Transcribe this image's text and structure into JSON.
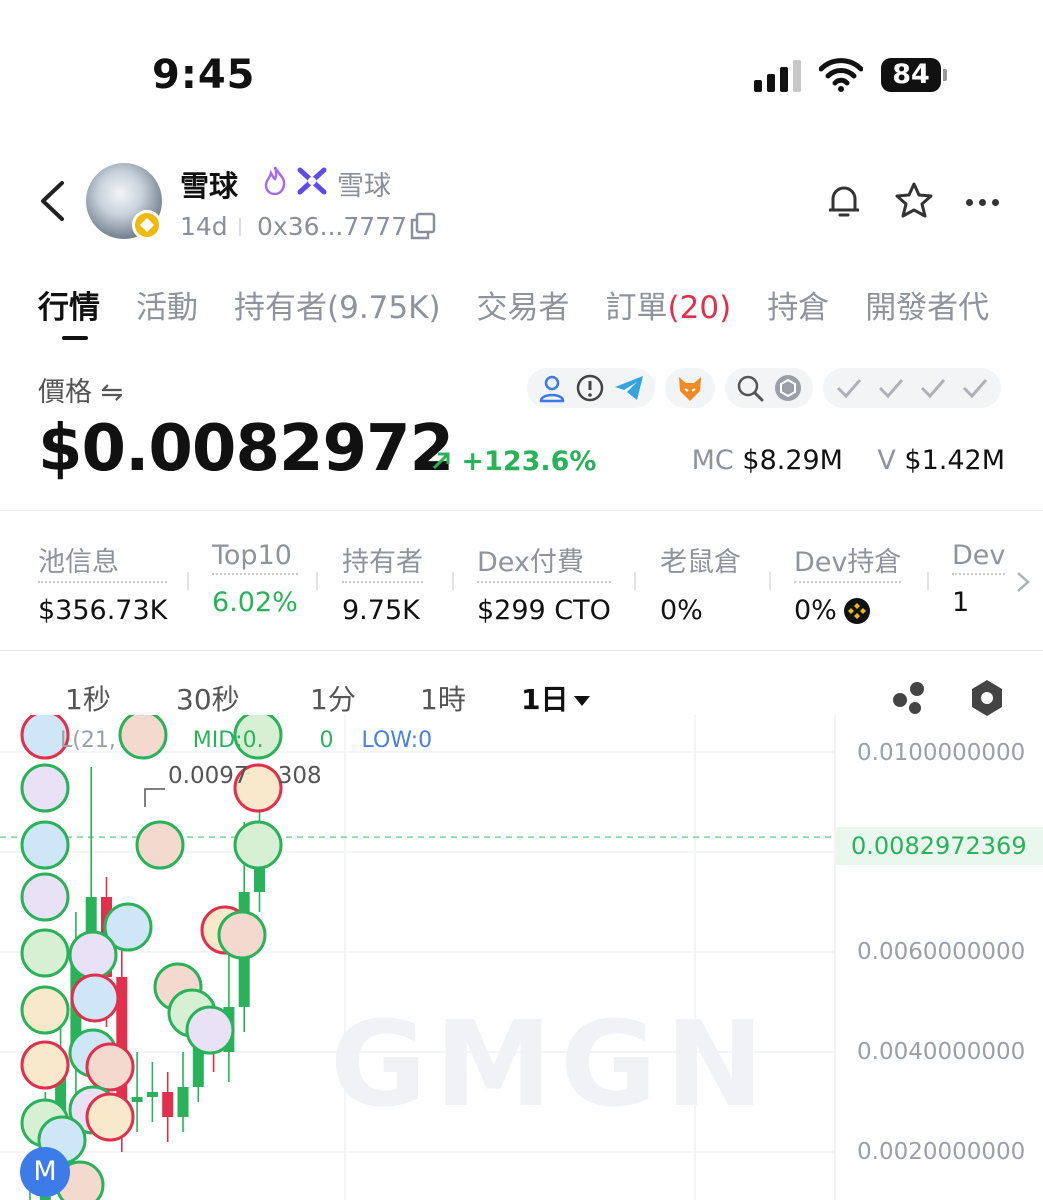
{
  "status_bar": {
    "time": "9:45",
    "battery": "84"
  },
  "header": {
    "token_name": "雪球",
    "alias": "雪球",
    "age": "14d",
    "address": "0x36...7777",
    "icons": [
      "back-arrow-icon",
      "bnb-chain-badge-icon",
      "flame-icon",
      "x-logo-icon",
      "copy-icon",
      "bell-icon",
      "star-icon",
      "more-icon"
    ]
  },
  "tabs": [
    {
      "label": "行情",
      "active": true
    },
    {
      "label": "活動"
    },
    {
      "label": "持有者(9.75K)"
    },
    {
      "label": "交易者"
    },
    {
      "label": "訂單",
      "count": "(20)"
    },
    {
      "label": "持倉"
    },
    {
      "label": "開發者代"
    }
  ],
  "price": {
    "label": "價格 ⇋",
    "value": "$0.0082972",
    "change": "+123.6%",
    "mc_label": "MC",
    "mc_value": "$8.29M",
    "v_label": "V",
    "v_value": "$1.42M"
  },
  "stats": [
    {
      "label": "池信息",
      "value": "$356.73K"
    },
    {
      "label": "Top10",
      "value": "6.02%",
      "green": true
    },
    {
      "label": "持有者",
      "value": "9.75K"
    },
    {
      "label": "Dex付費",
      "value": "$299 CTO"
    },
    {
      "label": "老鼠倉",
      "value": "0%"
    },
    {
      "label": "Dev持倉",
      "value": "0%"
    },
    {
      "label": "Dev",
      "value": "1"
    }
  ],
  "timeframes": [
    {
      "label": "1秒"
    },
    {
      "label": "30秒"
    },
    {
      "label": "1分"
    },
    {
      "label": "1時"
    },
    {
      "label": "1日",
      "active": true
    }
  ],
  "chart": {
    "ohlc_prefix": "L(21,",
    "mid": "MID:0.",
    "mid_tail": "0",
    "low": "LOW:0",
    "high_marker": "0.0097",
    "high_marker_tail": "308",
    "current_price": "0.0082972369",
    "watermark": "GMGN",
    "user_badge": "M",
    "up_color": "#2ab25b",
    "down_color": "#e0304d"
  },
  "chart_data": {
    "type": "candlestick",
    "y_axis_labels": [
      "0.0100000000",
      "0.0060000000",
      "0.0040000000",
      "0.0020000000"
    ],
    "ylim": [
      0.0004,
      0.0105
    ],
    "current_price": 0.0082972369,
    "candles_approx": [
      {
        "open": 0.0004,
        "close": 0.001,
        "high": 0.0014,
        "low": 0.0004
      },
      {
        "open": 0.001,
        "close": 0.002,
        "high": 0.0032,
        "low": 0.0004
      },
      {
        "open": 0.002,
        "close": 0.0038,
        "high": 0.0052,
        "low": 0.0015
      },
      {
        "open": 0.0038,
        "close": 0.0058,
        "high": 0.0068,
        "low": 0.003
      },
      {
        "open": 0.0058,
        "close": 0.0071,
        "high": 0.0097,
        "low": 0.005
      },
      {
        "open": 0.0071,
        "close": 0.0055,
        "high": 0.0075,
        "low": 0.0045
      },
      {
        "open": 0.0055,
        "close": 0.003,
        "high": 0.0062,
        "low": 0.002
      },
      {
        "open": 0.003,
        "close": 0.0031,
        "high": 0.004,
        "low": 0.0024
      },
      {
        "open": 0.0031,
        "close": 0.0032,
        "high": 0.0038,
        "low": 0.0026
      },
      {
        "open": 0.0032,
        "close": 0.0027,
        "high": 0.0036,
        "low": 0.0022
      },
      {
        "open": 0.0027,
        "close": 0.0033,
        "high": 0.004,
        "low": 0.0024
      },
      {
        "open": 0.0033,
        "close": 0.0044,
        "high": 0.0052,
        "low": 0.003
      },
      {
        "open": 0.0044,
        "close": 0.004,
        "high": 0.005,
        "low": 0.0036
      },
      {
        "open": 0.004,
        "close": 0.0049,
        "high": 0.0066,
        "low": 0.0034
      },
      {
        "open": 0.0049,
        "close": 0.0072,
        "high": 0.0086,
        "low": 0.0044
      },
      {
        "open": 0.0072,
        "close": 0.0083,
        "high": 0.009,
        "low": 0.0068
      }
    ]
  }
}
